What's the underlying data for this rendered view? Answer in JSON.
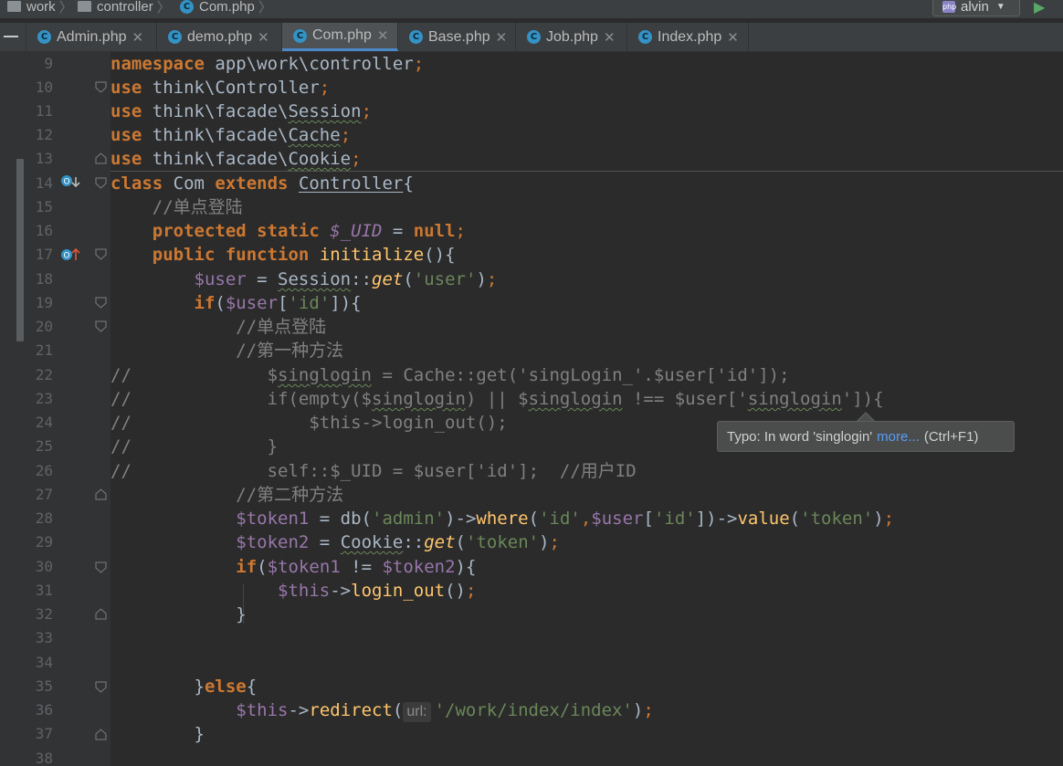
{
  "breadcrumb": {
    "items": [
      "work",
      "controller",
      "Com.php"
    ]
  },
  "user_select": {
    "label": "alvin"
  },
  "tabs": [
    {
      "label": "Admin.php",
      "active": false
    },
    {
      "label": "demo.php",
      "active": false
    },
    {
      "label": "Com.php",
      "active": true
    },
    {
      "label": "Base.php",
      "active": false
    },
    {
      "label": "Job.php",
      "active": false
    },
    {
      "label": "Index.php",
      "active": false
    }
  ],
  "line_numbers": [
    "9",
    "10",
    "11",
    "12",
    "13",
    "14",
    "15",
    "16",
    "17",
    "18",
    "19",
    "20",
    "21",
    "22",
    "23",
    "24",
    "25",
    "26",
    "27",
    "28",
    "29",
    "30",
    "31",
    "32",
    "33",
    "34",
    "35",
    "36",
    "37",
    "38"
  ],
  "code": {
    "l9": [
      "namespace",
      " app\\work\\controller",
      ";"
    ],
    "l10": [
      "use",
      " think\\Controller",
      ";"
    ],
    "l11": [
      "use",
      " think\\facade\\",
      "Session",
      ";"
    ],
    "l12": [
      "use",
      " think\\facade\\",
      "Cache",
      ";"
    ],
    "l13": [
      "use",
      " think\\facade\\",
      "Cookie",
      ";"
    ],
    "l14": [
      "class",
      " Com ",
      "extends",
      " ",
      "Controller",
      "{"
    ],
    "l15": [
      "    //单点登陆"
    ],
    "l16": [
      "    ",
      "protected static",
      " ",
      "$_UID",
      " = ",
      "null",
      ";"
    ],
    "l17": [
      "    ",
      "public function",
      " ",
      "initialize",
      "(){"
    ],
    "l18": [
      "        ",
      "$user",
      " = ",
      "Session",
      "::",
      "get",
      "(",
      "'user'",
      ")",
      ";"
    ],
    "l19": [
      "        ",
      "if",
      "(",
      "$user",
      "[",
      "'id'",
      "]){"
    ],
    "l20": [
      "            //单点登陆"
    ],
    "l21": [
      "            //第一种方法"
    ],
    "l22": [
      "//",
      "             $",
      "singlogin",
      " = Cache::get('singLogin_'.$user['id']);"
    ],
    "l23": [
      "//",
      "             if(empty($",
      "singlogin",
      ") || $",
      "singlogin",
      " !== $user['",
      "singlogin",
      "']){"
    ],
    "l24": [
      "//",
      "                 $this->login_out();"
    ],
    "l25": [
      "//",
      "             }"
    ],
    "l26": [
      "//",
      "             self::$_UID = $user['id'];  //用户ID"
    ],
    "l27": [
      "            //第二种方法"
    ],
    "l28": [
      "            ",
      "$token1",
      " = db(",
      "'admin'",
      ")->",
      "where",
      "(",
      "'id'",
      ",",
      "$user",
      "[",
      "'id'",
      "])->",
      "value",
      "(",
      "'token'",
      ")",
      ";"
    ],
    "l29": [
      "            ",
      "$token2",
      " = ",
      "Cookie",
      "::",
      "get",
      "(",
      "'token'",
      ")",
      ";"
    ],
    "l30": [
      "            ",
      "if",
      "(",
      "$token1",
      " != ",
      "$token2",
      "){"
    ],
    "l31": [
      "                ",
      "$this",
      "->",
      "login_out",
      "()",
      ";"
    ],
    "l32": [
      "            }"
    ],
    "l33": [
      ""
    ],
    "l34": [
      ""
    ],
    "l35": [
      "        }",
      "else",
      "{"
    ],
    "l36": [
      "            ",
      "$this",
      "->",
      "redirect",
      "(",
      "url:",
      "'/work/index/index'",
      ")",
      ";"
    ],
    "l37": [
      "        }"
    ],
    "l38": [
      ""
    ]
  },
  "tooltip": {
    "prefix": "Typo: In word 'singlogin'",
    "link": "more...",
    "suffix": "(Ctrl+F1)"
  },
  "icons": {
    "folder": "folder-icon",
    "php_class": "php-class-icon",
    "run": "run-icon",
    "override": "override-method-icon",
    "implement": "implemented-method-icon"
  },
  "colors": {
    "keyword": "#cc7832",
    "string": "#6a8759",
    "variable": "#9876aa",
    "function": "#ffc66d",
    "comment": "#808080",
    "text": "#a9b7c6",
    "background": "#2b2b2b",
    "accent": "#4a88c7"
  }
}
